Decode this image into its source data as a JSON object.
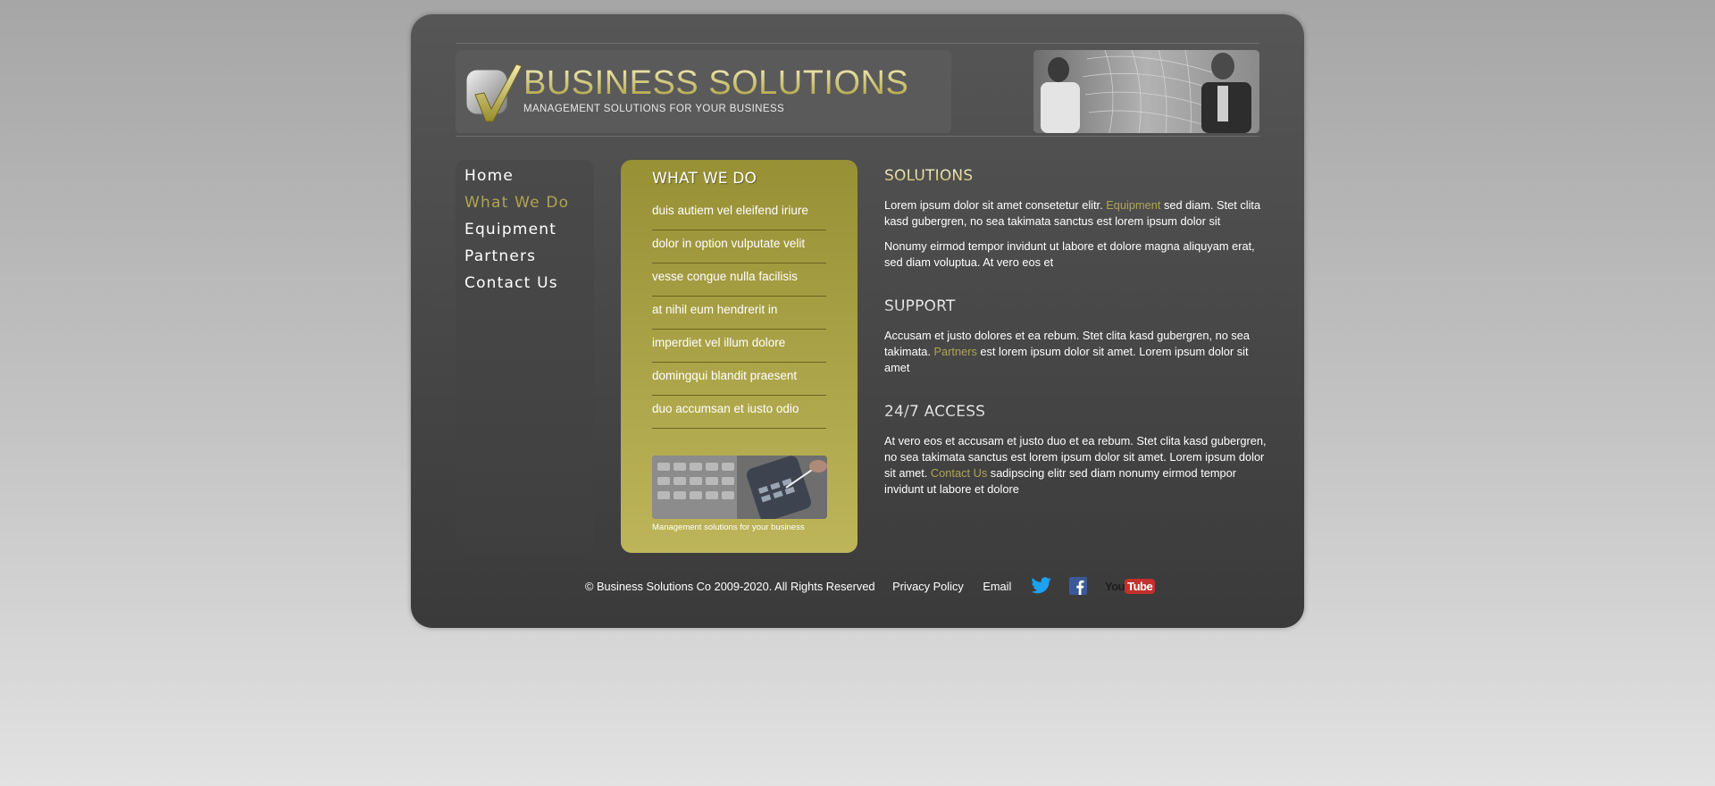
{
  "header": {
    "title": "BUSINESS SOLUTIONS",
    "tagline": "MANAGEMENT SOLUTIONS FOR YOUR BUSINESS"
  },
  "nav": {
    "items": [
      {
        "label": "Home"
      },
      {
        "label": "What We Do"
      },
      {
        "label": "Equipment"
      },
      {
        "label": "Partners"
      },
      {
        "label": "Contact Us"
      }
    ],
    "active": "What We Do"
  },
  "what_we_do": {
    "title": "WHAT WE DO",
    "items": [
      "duis autiem vel eleifend iriure",
      "dolor in option vulputate velit",
      "vesse congue nulla facilisis",
      "at nihil eum hendrerit in",
      "imperdiet vel illum dolore",
      "domingqui blandit praesent",
      "duo accumsan et iusto odio"
    ],
    "caption": "Management solutions for your business"
  },
  "solutions": {
    "title": "SOLUTIONS",
    "p1_a": "Lorem ipsum dolor sit amet consetetur elitr. ",
    "p1_link": "Equipment",
    "p1_b": " sed diam. Stet clita kasd gubergren, no sea takimata sanctus est lorem ipsum dolor sit",
    "p2": "Nonumy eirmod tempor invidunt ut labore et dolore magna aliquyam erat, sed diam voluptua. At vero eos et"
  },
  "support": {
    "title": "SUPPORT",
    "p1_a": "Accusam et justo dolores et ea rebum. Stet clita kasd gubergren, no sea takimata. ",
    "p1_link": "Partners",
    "p1_b": " est lorem ipsum dolor sit amet. Lorem ipsum dolor sit amet"
  },
  "access": {
    "title": "24/7 ACCESS",
    "p1_a": "At vero eos et accusam et justo duo et ea rebum. Stet clita kasd gubergren, no sea takimata sanctus est lorem ipsum dolor sit amet. Lorem ipsum dolor sit amet. ",
    "p1_link": "Contact Us",
    "p1_b": " sadipscing elitr sed diam nonumy eirmod tempor invidunt ut labore et dolore"
  },
  "footer": {
    "copyright": "© Business Solutions Co 2009-2020. All Rights Reserved",
    "privacy": "Privacy Policy",
    "email": "Email",
    "social": [
      "twitter-icon",
      "facebook-icon",
      "youtube-icon"
    ],
    "youtube_you": "You",
    "youtube_tube": "Tube"
  },
  "colors": {
    "accent_gold": "#b0a452",
    "panel_gold": "#aaa247",
    "frame_dark": "#474747",
    "twitter_blue": "#1da1f2",
    "facebook_blue": "#3b5998",
    "youtube_red": "#c4302b"
  }
}
